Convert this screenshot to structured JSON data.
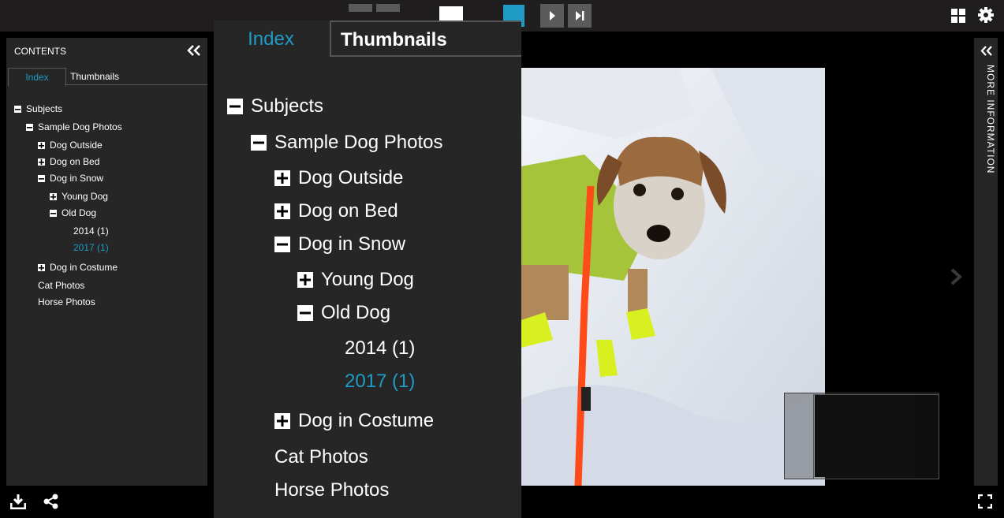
{
  "toolbar": {
    "colors": {
      "background": "#1f1d1e",
      "button": "#5a5a5a",
      "accent": "#1f9bc5"
    },
    "buttons": [
      "play-icon",
      "skip-to-end-icon"
    ],
    "right_icons": [
      "grid-icon",
      "gear-icon"
    ]
  },
  "contents": {
    "title": "CONTENTS",
    "tabs": {
      "index": "Index",
      "thumbnails": "Thumbnails"
    },
    "tree": [
      {
        "label": "Subjects",
        "state": "expanded",
        "depth": 0
      },
      {
        "label": "Sample Dog Photos",
        "state": "expanded",
        "depth": 1
      },
      {
        "label": "Dog Outside",
        "state": "collapsed",
        "depth": 2
      },
      {
        "label": "Dog on Bed",
        "state": "collapsed",
        "depth": 2
      },
      {
        "label": "Dog in Snow",
        "state": "expanded",
        "depth": 2
      },
      {
        "label": "Young Dog",
        "state": "collapsed",
        "depth": 3
      },
      {
        "label": "Old Dog",
        "state": "expanded",
        "depth": 3
      },
      {
        "label": "2014 (1)",
        "state": "leaf",
        "depth": 4
      },
      {
        "label": "2017 (1)",
        "state": "leaf-selected",
        "depth": 4
      },
      {
        "label": "Dog in Costume",
        "state": "collapsed",
        "depth": 2
      },
      {
        "label": "Cat Photos",
        "state": "leaf",
        "depth": 1
      },
      {
        "label": "Horse Photos",
        "state": "leaf",
        "depth": 1
      }
    ]
  },
  "info_panel": {
    "label": "MORE INFORMATION"
  },
  "bottom_icons": [
    "download-icon",
    "share-icon",
    "fullscreen-icon"
  ]
}
